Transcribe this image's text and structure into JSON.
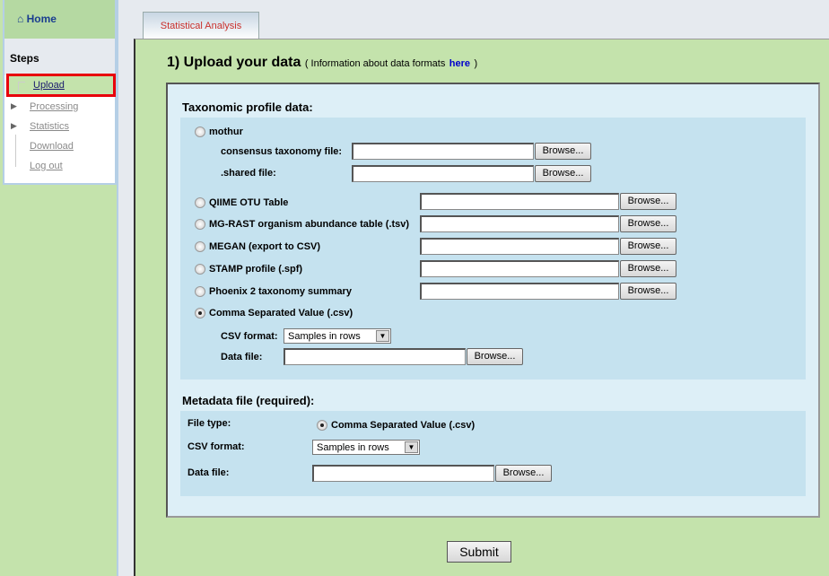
{
  "sidebar": {
    "home": "Home",
    "steps": "Steps",
    "items": [
      {
        "label": "Upload",
        "active": true
      },
      {
        "label": "Processing"
      },
      {
        "label": "Statistics"
      },
      {
        "label": "Download"
      },
      {
        "label": "Log out"
      }
    ]
  },
  "tab": "Statistical Analysis",
  "heading": {
    "title": "1) Upload your data",
    "info_pre": "( Information about data formats",
    "link": "here",
    "info_post": ")"
  },
  "taxonomic": {
    "title": "Taxonomic profile data:",
    "mothur": "mothur",
    "consensus": "consensus taxonomy file:",
    "shared": ".shared file:",
    "options": [
      "QIIME OTU Table",
      "MG-RAST organism abundance table (.tsv)",
      "MEGAN (export to CSV)",
      "STAMP profile (.spf)",
      "Phoenix 2 taxonomy summary"
    ],
    "csv": "Comma Separated Value (.csv)",
    "csv_format_label": "CSV format:",
    "csv_format_value": "Samples in rows",
    "data_file_label": "Data file:",
    "selected": "csv"
  },
  "metadata": {
    "title": "Metadata file (required):",
    "file_type_label": "File type:",
    "file_type_value": "Comma Separated Value (.csv)",
    "csv_format_label": "CSV format:",
    "csv_format_value": "Samples in rows",
    "data_file_label": "Data file:"
  },
  "browse": "Browse...",
  "submit": "Submit"
}
